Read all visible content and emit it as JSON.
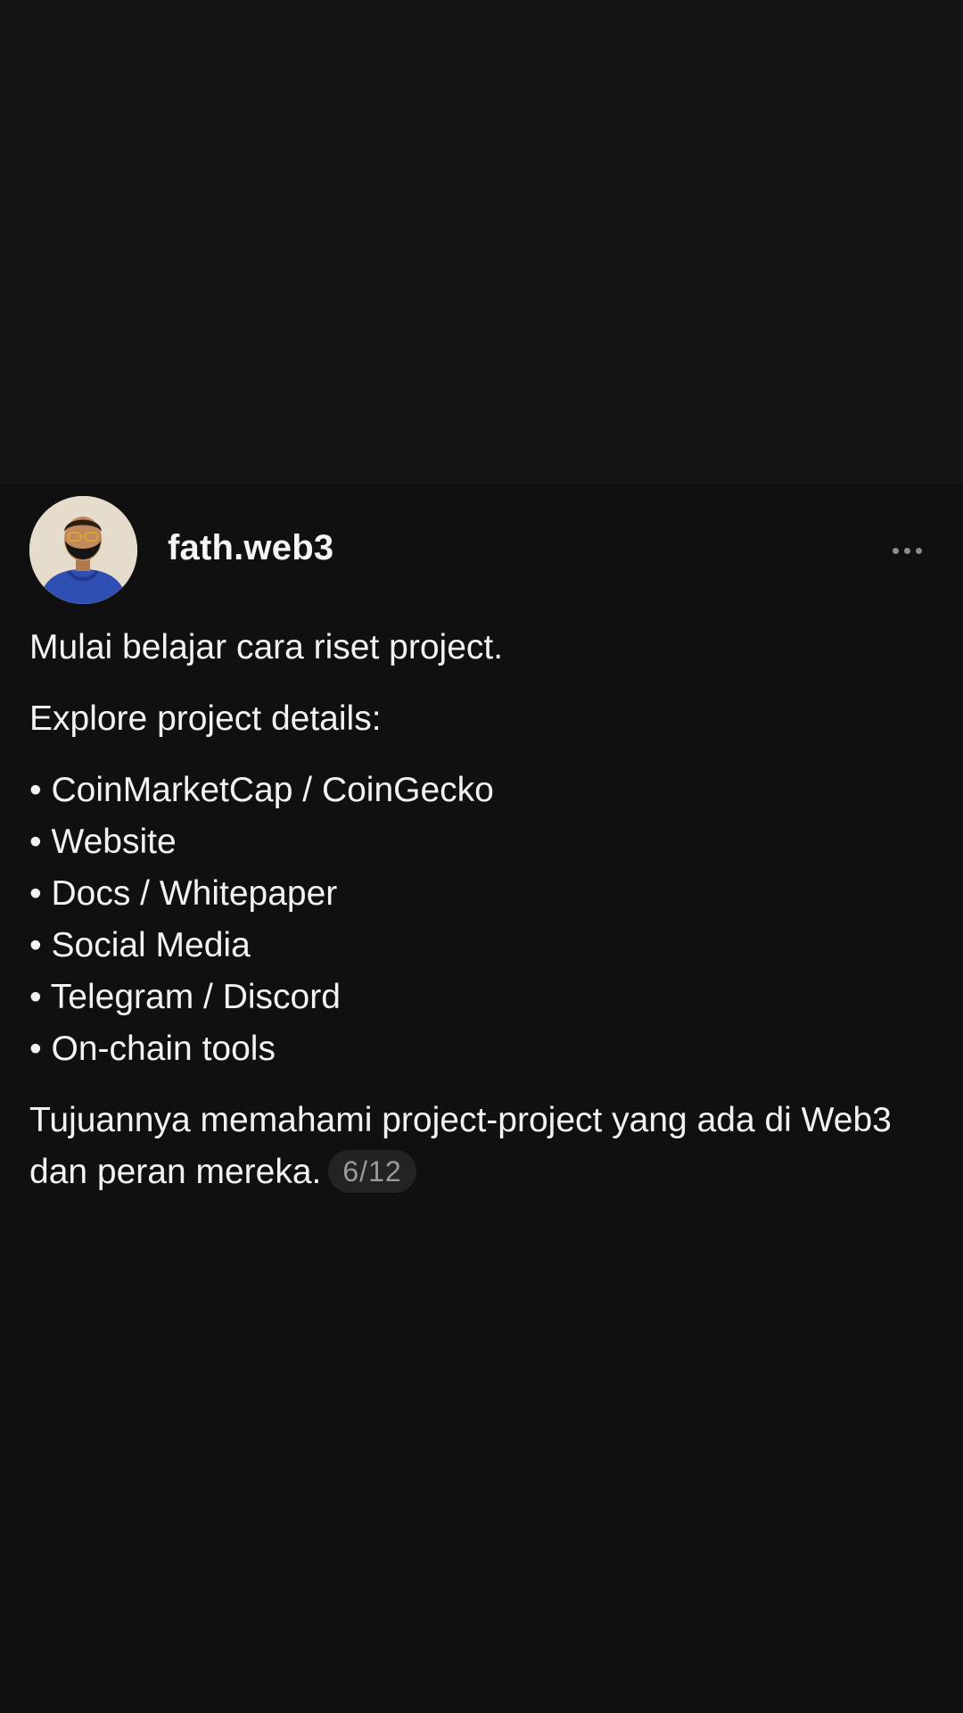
{
  "post": {
    "username": "fath.web3",
    "paragraphs": [
      "Mulai belajar cara riset project.",
      "Explore project details:"
    ],
    "bullets": [
      "• CoinMarketCap / CoinGecko",
      "• Website",
      "• Docs / Whitepaper",
      "• Social Media",
      "• Telegram / Discord",
      "• On-chain tools"
    ],
    "closing": "Tujuannya memahami project-project yang ada di Web3 dan peran mereka.",
    "page_indicator": "6/12"
  },
  "icons": {
    "avatar": "avatar-icon",
    "more": "more-options-icon"
  },
  "colors": {
    "background": "#121212",
    "text": "#f2f2f2",
    "badge_bg": "#232323",
    "badge_text": "#9a9a9a"
  }
}
